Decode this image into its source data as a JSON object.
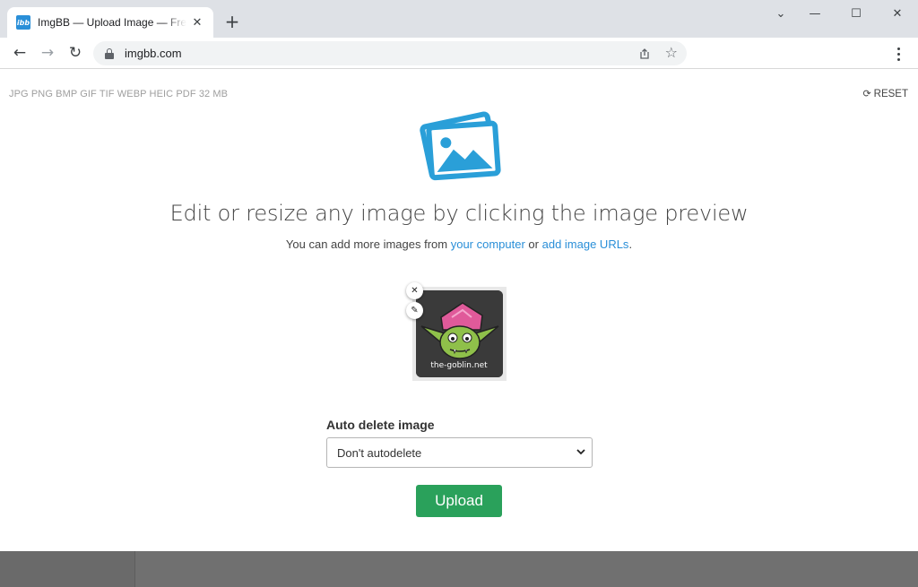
{
  "browser": {
    "tab_title": "ImgBB — Upload Image — Free",
    "tab_favicon_text": "ibb",
    "url": "imgbb.com"
  },
  "page": {
    "formats_text": "JPG PNG BMP GIF TIF WEBP HEIC PDF  32 MB",
    "reset_label": "RESET",
    "headline": "Edit or resize any image by clicking the image preview",
    "subline_prefix": "You can add more images from ",
    "subline_link1": "your computer",
    "subline_middle": " or ",
    "subline_link2": "add image URLs",
    "subline_suffix": ".",
    "thumbnail_caption": "the-goblin.net",
    "auto_delete_label": "Auto delete image",
    "auto_delete_value": "Don't autodelete",
    "upload_label": "Upload"
  },
  "colors": {
    "accent_blue": "#2a8fd8",
    "upload_green": "#2aa15b",
    "footer_gray": "#6a6a6a"
  },
  "icons": [
    "close-icon",
    "new-tab-icon",
    "minimize-icon",
    "maximize-icon",
    "back-arrow-icon",
    "forward-arrow-icon",
    "reload-icon",
    "lock-icon",
    "share-icon",
    "star-icon",
    "menu-icon",
    "reset-icon",
    "image-gallery-icon",
    "remove-icon",
    "pencil-icon",
    "chevron-down-icon"
  ]
}
